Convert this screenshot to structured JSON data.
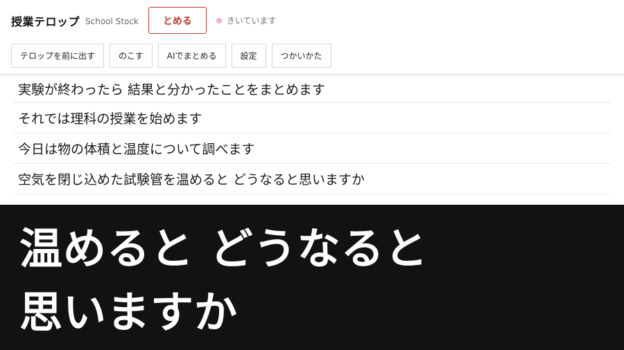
{
  "header": {
    "title": "授業テロップ",
    "subtitle": "School Stock",
    "stop_label": "とめる",
    "status_text": "きいています",
    "status_dot_color": "#e8b7bb"
  },
  "toolbar": {
    "buttons": [
      "テロップを前に出す",
      "のこす",
      "AIでまとめる",
      "設定",
      "つかいかた"
    ]
  },
  "transcript": {
    "lines": [
      "実験が終わったら 結果と分かったことをまとめます",
      "それでは理科の授業を始めます",
      "今日は物の体積と温度について調べます",
      "空気を閉じ込めた試験管を温めると どうなると思いますか"
    ]
  },
  "telop": {
    "lines": [
      "温めると どうなると",
      "思いますか"
    ]
  },
  "colors": {
    "accent": "#c0392b",
    "telop_background": "#111213",
    "telop_text": "#ffffff"
  }
}
